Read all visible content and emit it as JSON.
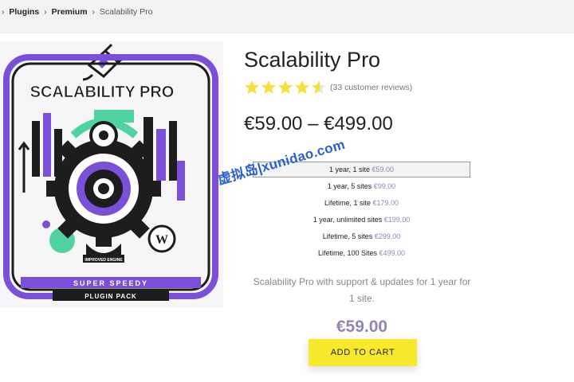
{
  "breadcrumb": {
    "items": [
      "Plugins",
      "Premium"
    ],
    "current": "Scalability Pro"
  },
  "product": {
    "image_alt": "Scalability Pro",
    "image_text": {
      "title": "SCALABILITY PRO",
      "badge": "IMPROVED ENGINE",
      "banner_line1": "SUPER SPEEDY",
      "banner_line2": "PLUGIN PACK"
    },
    "title": "Scalability Pro",
    "rating": 4.5,
    "reviews": "(33 customer reviews)",
    "price_range": "€59.00 – €499.00",
    "options": [
      {
        "label": "1 year, 1 site",
        "price": "€59.00",
        "selected": true
      },
      {
        "label": "1 year, 5 sites",
        "price": "€99.00",
        "selected": false
      },
      {
        "label": "Lifetime, 1 site",
        "price": "€179.00",
        "selected": false
      },
      {
        "label": "1 year, unlimited sites",
        "price": "€199.00",
        "selected": false
      },
      {
        "label": "Lifetime, 5 sites",
        "price": "€299.00",
        "selected": false
      },
      {
        "label": "Lifetime, 100 Sites",
        "price": "€499.00",
        "selected": false
      }
    ],
    "description": "Scalability Pro with support & updates for 1 year for 1 site.",
    "selected_price": "€59.00",
    "add_to_cart": "ADD TO CART"
  },
  "watermark": "虚拟岛|xunidao.com",
  "colors": {
    "accent_purple": "#8f86b8",
    "button_yellow": "#f7ea2c",
    "star_yellow": "#f5e13a",
    "image_purple": "#7b4fd8"
  }
}
